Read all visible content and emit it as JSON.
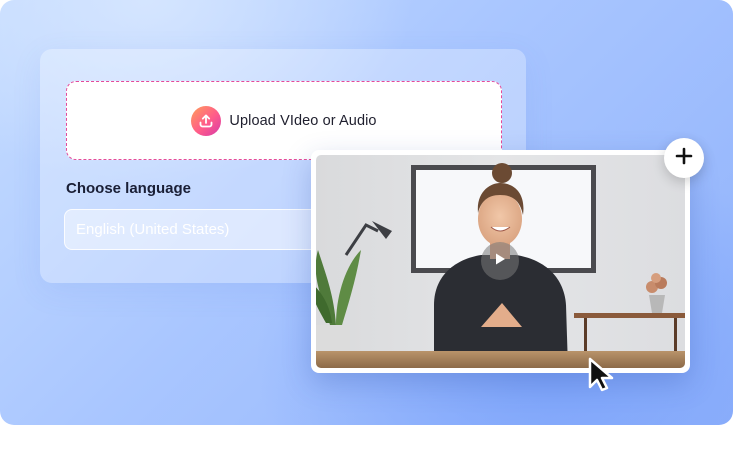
{
  "upload": {
    "label": "Upload VIdeo or Audio",
    "icon": "upload-icon"
  },
  "language": {
    "label": "Choose language",
    "selected": "English (United States)"
  },
  "video": {
    "play_icon": "play-icon",
    "add_icon": "plus-icon",
    "cursor_icon": "mouse-cursor-icon"
  },
  "colors": {
    "accent_pink": "#e44a9a",
    "accent_orange": "#ff9f5a",
    "background_blue": "#a9c6ff"
  }
}
